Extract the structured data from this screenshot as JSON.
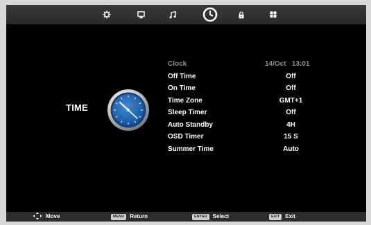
{
  "tabs": [
    {
      "icon": "picture-gear-icon",
      "active": false
    },
    {
      "icon": "monitor-icon",
      "active": false
    },
    {
      "icon": "music-note-icon",
      "active": false
    },
    {
      "icon": "clock-icon",
      "active": true
    },
    {
      "icon": "lock-icon",
      "active": false
    },
    {
      "icon": "grid-icon",
      "active": false
    }
  ],
  "page": {
    "title": "TIME"
  },
  "clock_row": {
    "label": "Clock",
    "value": "14/Oct   13:01"
  },
  "menu": [
    {
      "label": "Off Time",
      "value": "Off"
    },
    {
      "label": "On Time",
      "value": "Off"
    },
    {
      "label": "Time Zone",
      "value": "GMT+1"
    },
    {
      "label": "Sleep Timer",
      "value": "Off"
    },
    {
      "label": "Auto Standby",
      "value": "4H"
    },
    {
      "label": "OSD Timer",
      "value": "15 S"
    },
    {
      "label": "Summer Time",
      "value": "Auto"
    }
  ],
  "footer": [
    {
      "key": "",
      "label": "Move"
    },
    {
      "key": "MENU",
      "label": "Return"
    },
    {
      "key": "ENTER",
      "label": "Select"
    },
    {
      "key": "EXIT",
      "label": "Exit"
    }
  ],
  "colors": {
    "background": "#000000",
    "accent_blue": "#1f5fa8",
    "text": "#ffffff",
    "disabled_text": "#8a8a8a"
  }
}
